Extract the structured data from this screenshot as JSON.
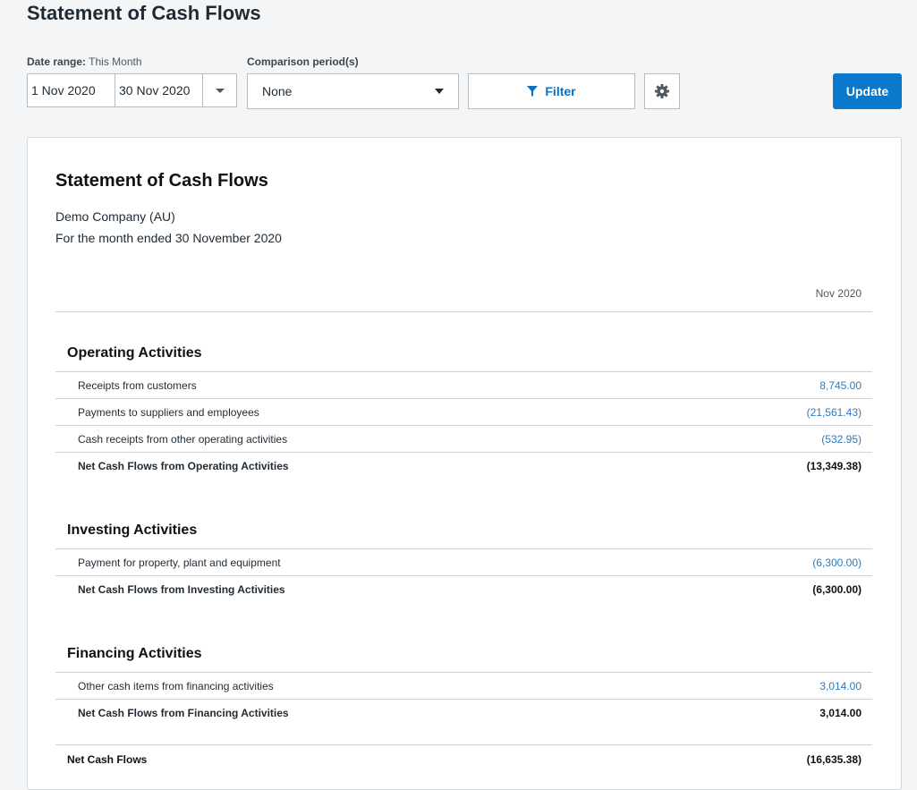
{
  "page": {
    "title": "Statement of Cash Flows"
  },
  "controls": {
    "date_range_label": "Date range:",
    "date_range_value": "This Month",
    "start_date": "1 Nov 2020",
    "end_date": "30 Nov 2020",
    "comparison_label": "Comparison period(s)",
    "comparison_value": "None",
    "filter_label": "Filter",
    "update_label": "Update",
    "accent_color": "#0a78cc"
  },
  "report": {
    "title": "Statement of Cash Flows",
    "company": "Demo Company (AU)",
    "period": "For the month ended 30 November 2020",
    "column": "Nov 2020",
    "sections": [
      {
        "title": "Operating Activities",
        "rows": [
          {
            "label": "Receipts from customers",
            "value": "8,745.00"
          },
          {
            "label": "Payments to suppliers and employees",
            "value": "(21,561.43)"
          },
          {
            "label": "Cash receipts from other operating activities",
            "value": "(532.95)"
          }
        ],
        "total": {
          "label": "Net Cash Flows from Operating Activities",
          "value": "(13,349.38)"
        }
      },
      {
        "title": "Investing Activities",
        "rows": [
          {
            "label": "Payment for property, plant and equipment",
            "value": "(6,300.00)"
          }
        ],
        "total": {
          "label": "Net Cash Flows from Investing Activities",
          "value": "(6,300.00)"
        }
      },
      {
        "title": "Financing Activities",
        "rows": [
          {
            "label": "Other cash items from financing activities",
            "value": "3,014.00"
          }
        ],
        "total": {
          "label": "Net Cash Flows from Financing Activities",
          "value": "3,014.00"
        }
      }
    ],
    "net": {
      "label": "Net Cash Flows",
      "value": "(16,635.38)"
    }
  }
}
